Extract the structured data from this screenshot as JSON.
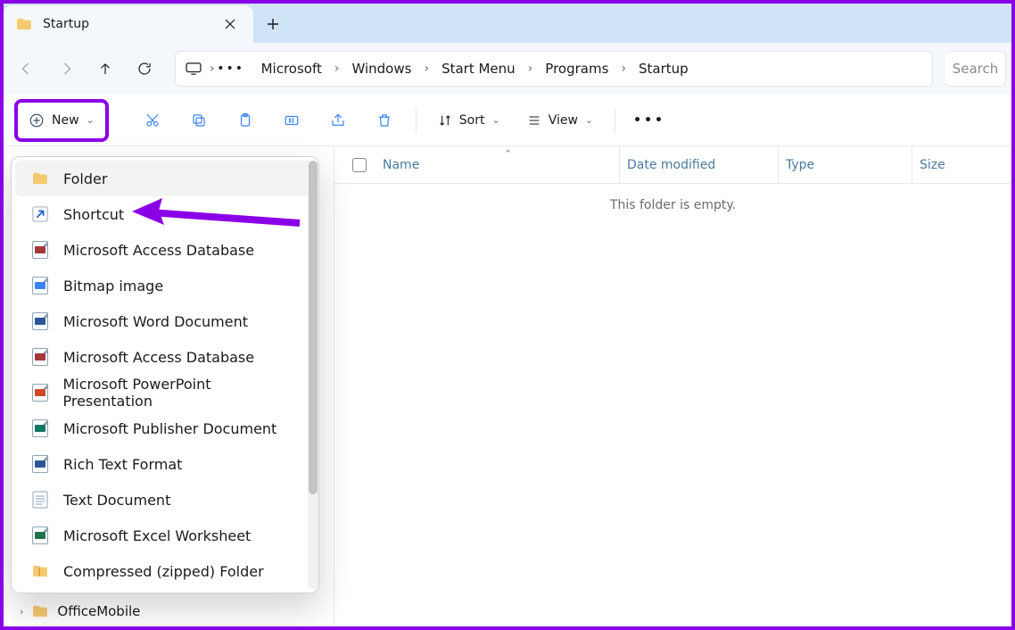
{
  "tab": {
    "title": "Startup"
  },
  "nav": {
    "canBack": false,
    "canForward": false
  },
  "breadcrumb": {
    "segments": [
      "Microsoft",
      "Windows",
      "Start Menu",
      "Programs",
      "Startup"
    ]
  },
  "search": {
    "placeholder": "Search"
  },
  "toolbar": {
    "new_label": "New",
    "sort_label": "Sort",
    "view_label": "View"
  },
  "columns": {
    "name": "Name",
    "date": "Date modified",
    "type": "Type",
    "size": "Size"
  },
  "main": {
    "empty_message": "This folder is empty."
  },
  "tree": {
    "visible_item": "OfficeMobile"
  },
  "new_menu": {
    "items": [
      {
        "label": "Folder",
        "icon": "folder",
        "hover": true
      },
      {
        "label": "Shortcut",
        "icon": "shortcut"
      },
      {
        "label": "Microsoft Access Database",
        "icon": "access"
      },
      {
        "label": "Bitmap image",
        "icon": "bitmap"
      },
      {
        "label": "Microsoft Word Document",
        "icon": "word"
      },
      {
        "label": "Microsoft Access Database",
        "icon": "access"
      },
      {
        "label": "Microsoft PowerPoint Presentation",
        "icon": "powerpoint"
      },
      {
        "label": "Microsoft Publisher Document",
        "icon": "publisher"
      },
      {
        "label": "Rich Text Format",
        "icon": "rtf"
      },
      {
        "label": "Text Document",
        "icon": "text"
      },
      {
        "label": "Microsoft Excel Worksheet",
        "icon": "excel"
      },
      {
        "label": "Compressed (zipped) Folder",
        "icon": "zip"
      }
    ]
  },
  "annotation": {
    "highlights": [
      "new-button",
      "shortcut-menu-item"
    ]
  }
}
